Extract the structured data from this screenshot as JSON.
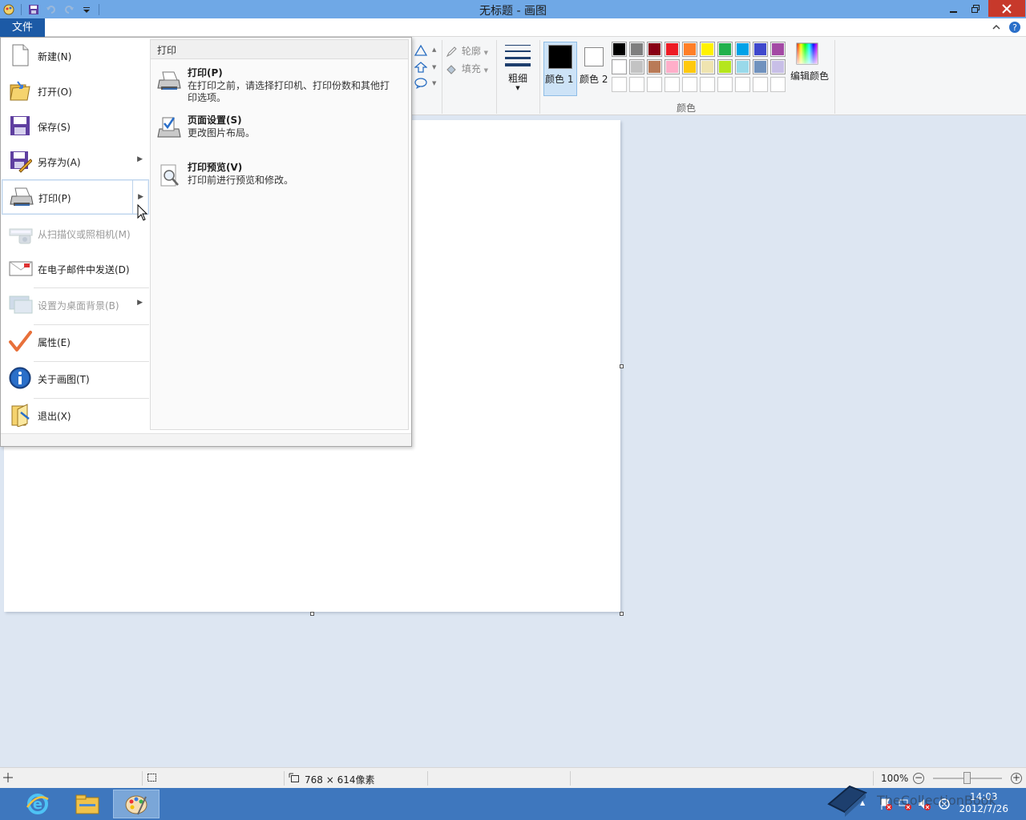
{
  "window": {
    "title": "无标题 - 画图"
  },
  "ribbon": {
    "file_tab": "文件",
    "shapes": {
      "outline_label": "轮廓",
      "fill_label": "填充"
    },
    "size_label": "粗细",
    "color1_label": "颜色 1",
    "color2_label": "颜色 2",
    "edit_colors_label": "编辑颜色",
    "colors_group_label": "颜色",
    "palette_row1": [
      "#000000",
      "#7f7f7f",
      "#880015",
      "#ed1c24",
      "#ff7f27",
      "#fff200",
      "#22b14c",
      "#00a2e8",
      "#3f48cc",
      "#a349a4"
    ],
    "palette_row2": [
      "#ffffff",
      "#c3c3c3",
      "#b97a57",
      "#ffaec9",
      "#ffc90e",
      "#efe4b0",
      "#b5e61d",
      "#99d9ea",
      "#7092be",
      "#c8bfe7"
    ],
    "color1": "#000000",
    "color2": "#ffffff"
  },
  "file_menu": {
    "items": [
      {
        "label": "新建(N)",
        "icon": "new-document-icon",
        "disabled": false
      },
      {
        "label": "打开(O)",
        "icon": "open-folder-icon",
        "disabled": false
      },
      {
        "label": "保存(S)",
        "icon": "save-floppy-icon",
        "disabled": false
      },
      {
        "label": "另存为(A)",
        "icon": "save-as-icon",
        "disabled": false
      },
      {
        "label": "打印(P)",
        "icon": "printer-icon",
        "disabled": false
      },
      {
        "label": "从扫描仪或照相机(M)",
        "icon": "scanner-icon",
        "disabled": true
      },
      {
        "label": "在电子邮件中发送(D)",
        "icon": "email-icon",
        "disabled": false
      },
      {
        "label": "设置为桌面背景(B)",
        "icon": "desktop-background-icon",
        "disabled": true
      },
      {
        "label": "属性(E)",
        "icon": "checkmark-icon",
        "disabled": false
      },
      {
        "label": "关于画图(T)",
        "icon": "info-icon",
        "disabled": false
      },
      {
        "label": "退出(X)",
        "icon": "exit-icon",
        "disabled": false
      }
    ],
    "submenu": {
      "header": "打印",
      "items": [
        {
          "title": "打印(P)",
          "desc": "在打印之前，请选择打印机、打印份数和其他打印选项。",
          "icon": "printer-icon"
        },
        {
          "title": "页面设置(S)",
          "desc": "更改图片布局。",
          "icon": "page-setup-icon"
        },
        {
          "title": "打印预览(V)",
          "desc": "打印前进行预览和修改。",
          "icon": "print-preview-icon"
        }
      ]
    }
  },
  "status": {
    "dimensions": "768 × 614像素",
    "zoom": "100%",
    "zoom_fraction": 0.5
  },
  "taskbar": {
    "time": "14:03",
    "date": "2012/7/26",
    "watermark": "TheCollectionBook"
  }
}
